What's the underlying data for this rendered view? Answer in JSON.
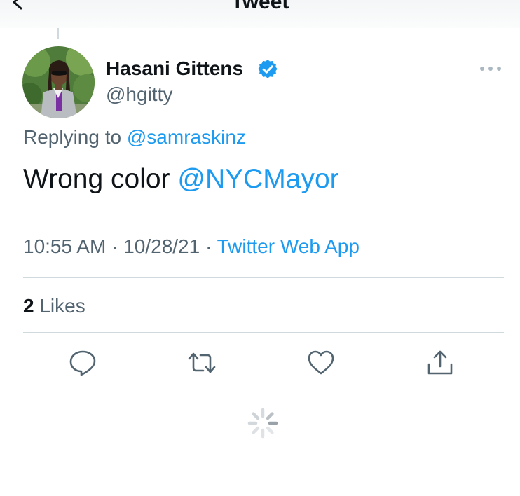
{
  "header": {
    "title": "Tweet",
    "back_icon": "chevron-left-icon"
  },
  "tweet": {
    "author": {
      "name": "Hasani Gittens",
      "handle": "@hgitty",
      "verified": true
    },
    "reply_prefix": "Replying to",
    "reply_to": "@samraskinz",
    "text": "Wrong color",
    "mention": "@NYCMayor",
    "time": "10:55 AM",
    "date": "10/28/21",
    "separator": "·",
    "source": "Twitter Web App",
    "likes_count": "2",
    "likes_label": "Likes"
  },
  "actions": [
    "reply-icon",
    "retweet-icon",
    "like-icon",
    "share-icon"
  ],
  "colors": {
    "accent": "#1d9bf0",
    "secondary_text": "#536471",
    "primary_text": "#0f1419",
    "divider": "#cfd9de"
  }
}
